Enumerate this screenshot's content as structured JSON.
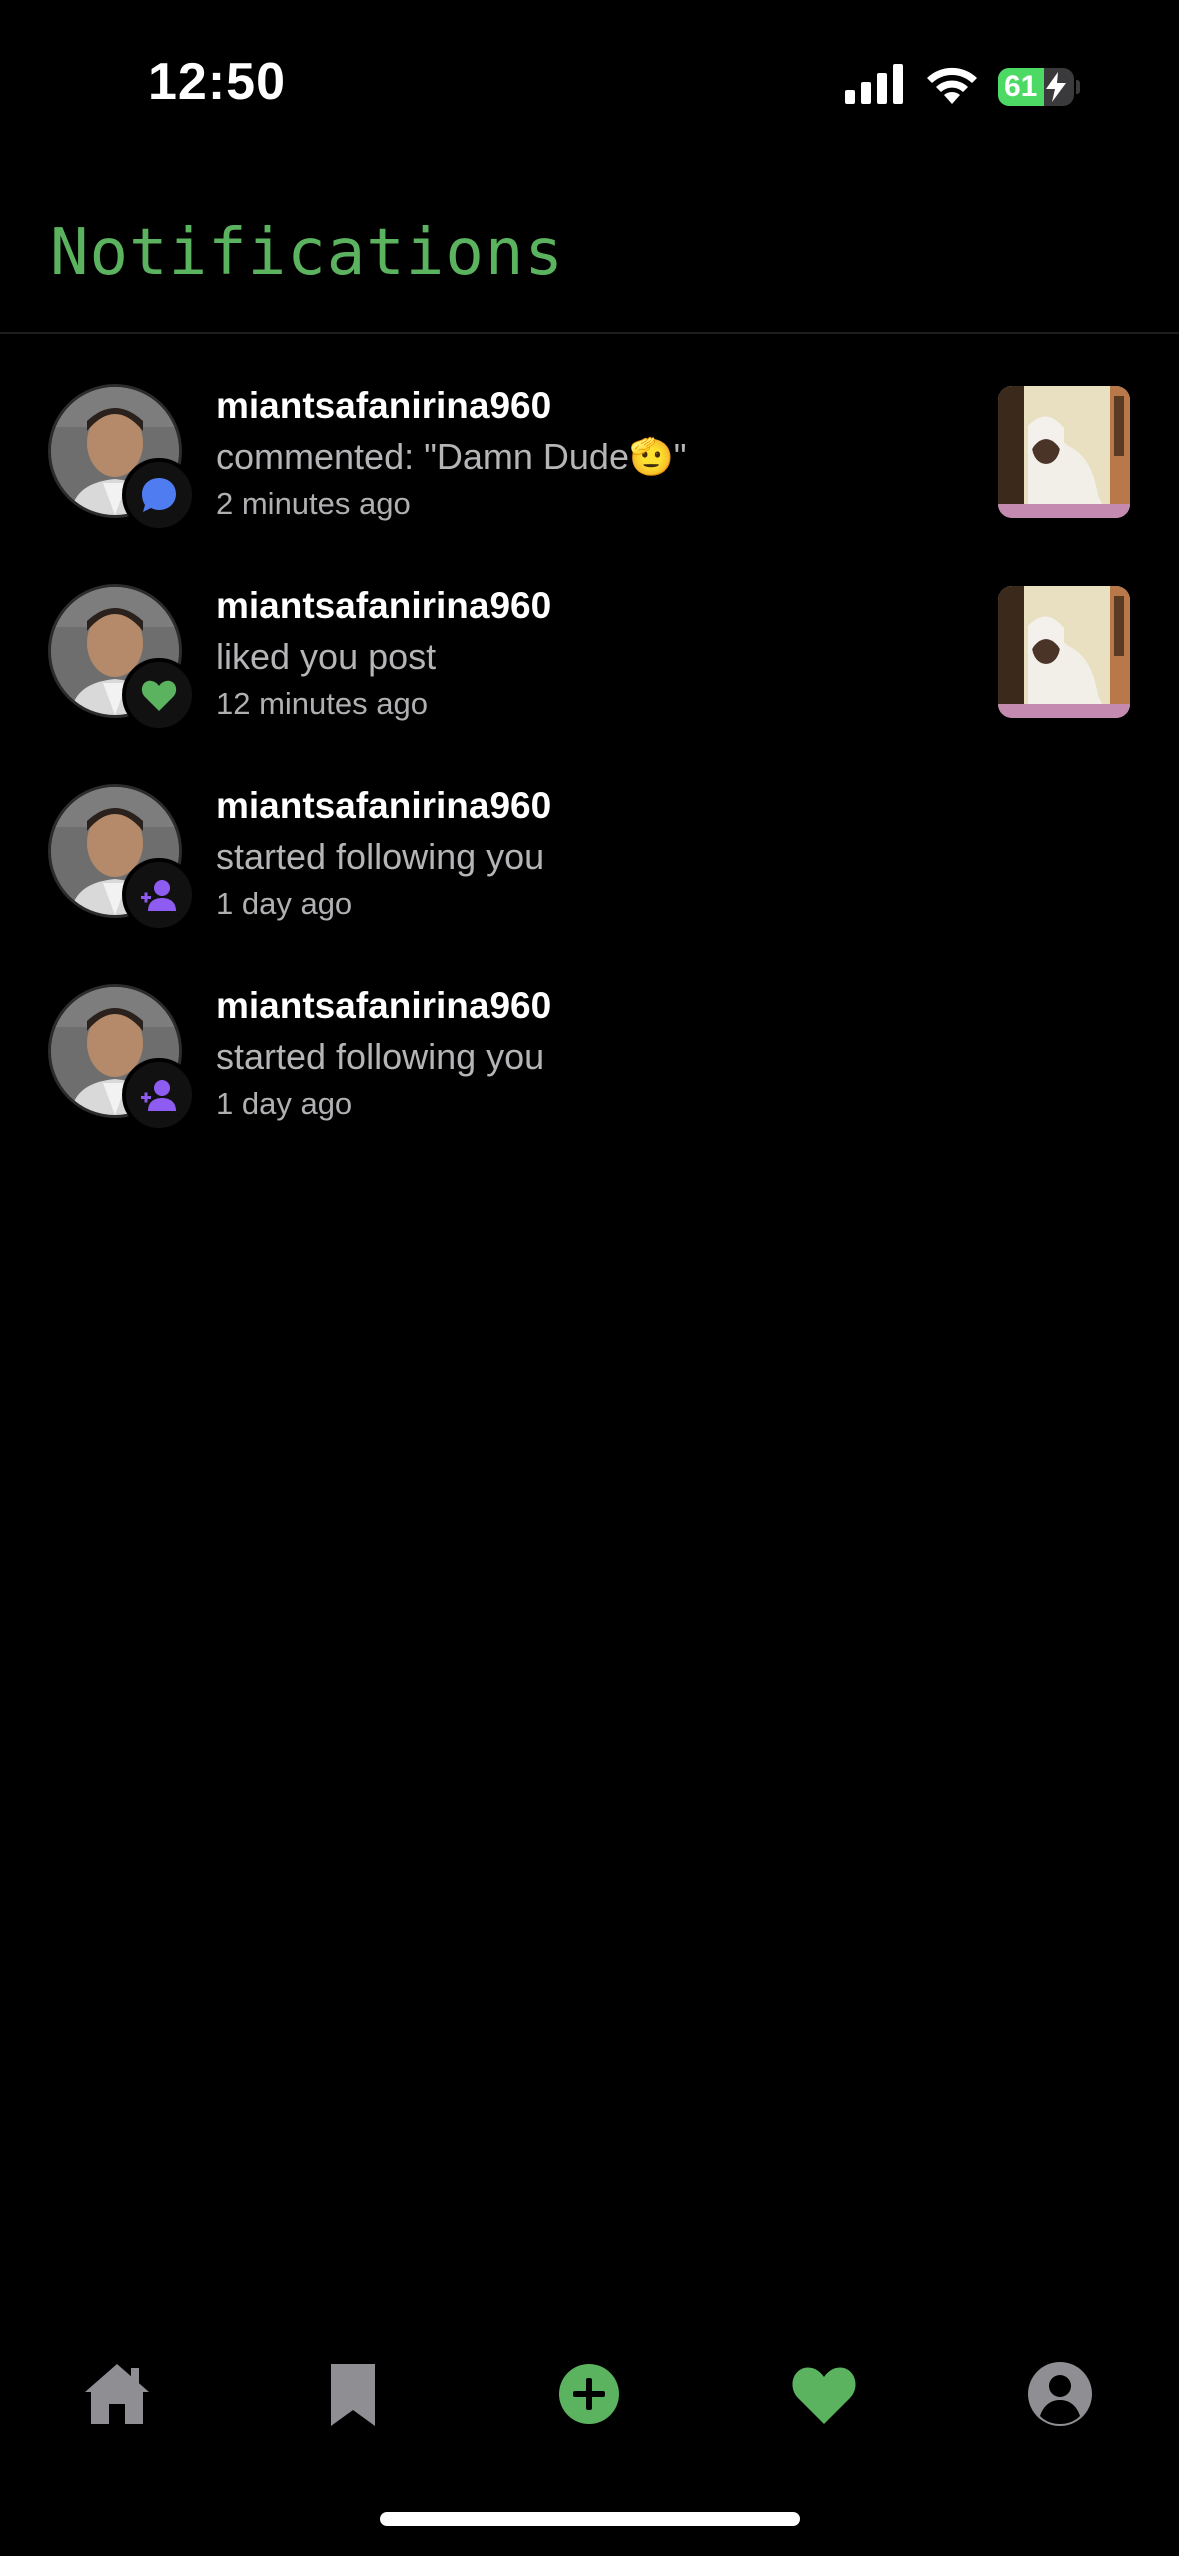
{
  "status_bar": {
    "time": "12:50",
    "battery_level": 61,
    "battery_label": "61",
    "charging": true
  },
  "header": {
    "title": "Notifications"
  },
  "notifications": [
    {
      "username": "miantsafanirina960",
      "action": "commented: \"Damn Dude🫡\"",
      "time": "2 minutes ago",
      "type": "comment",
      "has_post_thumbnail": true
    },
    {
      "username": "miantsafanirina960",
      "action": "liked you post",
      "time": "12 minutes ago",
      "type": "like",
      "has_post_thumbnail": true
    },
    {
      "username": "miantsafanirina960",
      "action": "started following you",
      "time": "1 day ago",
      "type": "follow",
      "has_post_thumbnail": false
    },
    {
      "username": "miantsafanirina960",
      "action": "started following you",
      "time": "1 day ago",
      "type": "follow",
      "has_post_thumbnail": false
    }
  ],
  "tab_bar": {
    "items": [
      {
        "icon": "home-icon",
        "active": false
      },
      {
        "icon": "bookmark-icon",
        "active": false
      },
      {
        "icon": "add-post-icon",
        "active": false
      },
      {
        "icon": "heart-icon",
        "active": true
      },
      {
        "icon": "profile-icon",
        "active": false
      }
    ]
  },
  "colors": {
    "accent": "#5bb35f",
    "comment_badge": "#4f7cf0",
    "like_badge": "#5bb35f",
    "follow_badge": "#8e5cf0",
    "inactive_icon": "#8e8e93",
    "background": "#000000"
  }
}
